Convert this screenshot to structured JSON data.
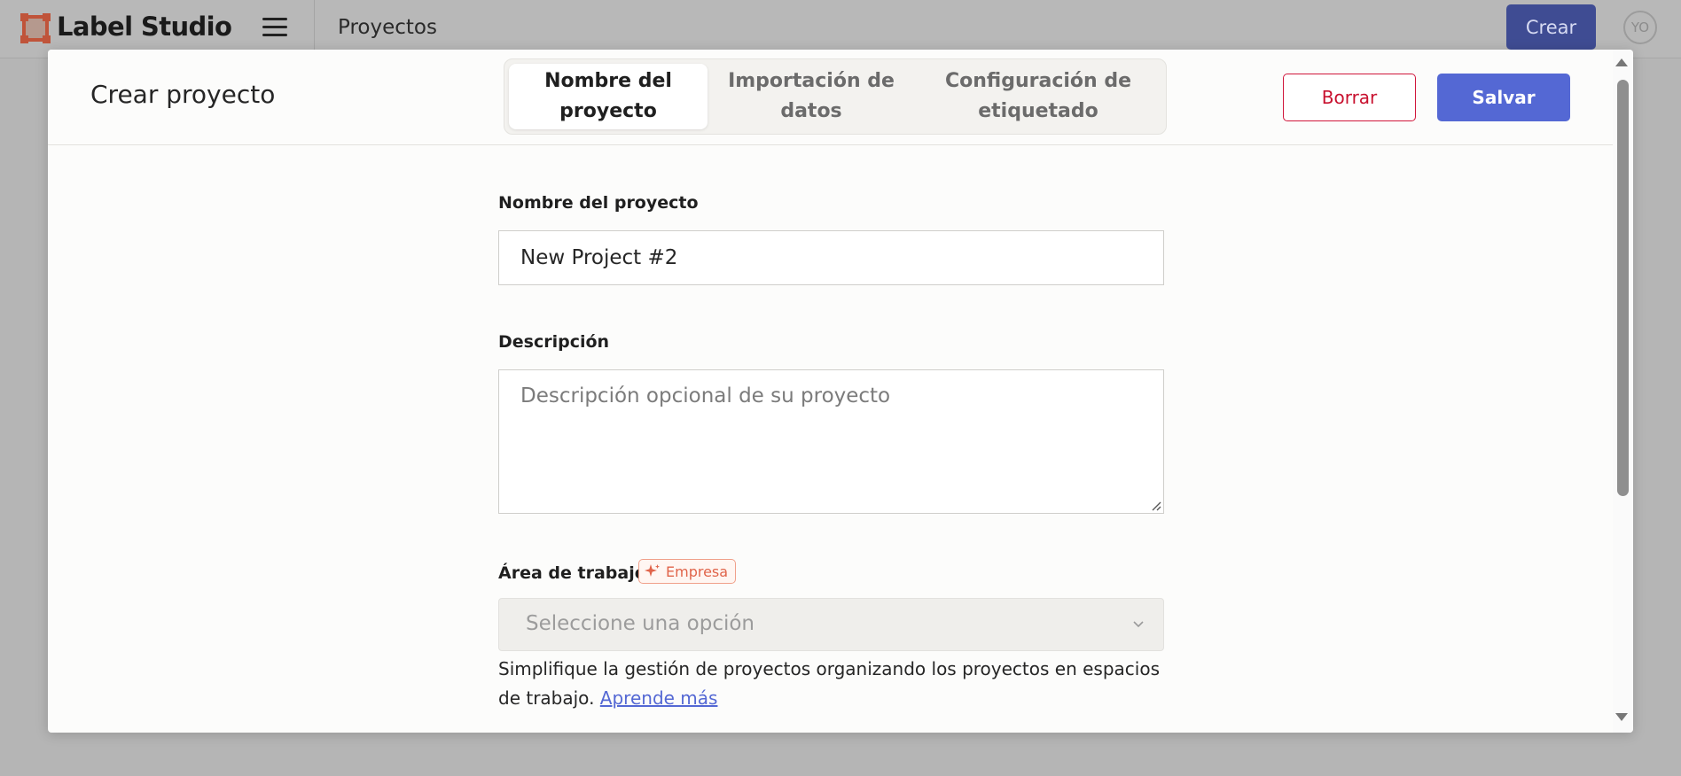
{
  "app": {
    "brand": "Label Studio",
    "breadcrumb": "Proyectos",
    "create_button": "Crear",
    "avatar_initials": "YO"
  },
  "modal": {
    "title": "Crear proyecto",
    "tabs": [
      {
        "label": "Nombre del proyecto",
        "active": true
      },
      {
        "label": "Importación de datos",
        "active": false
      },
      {
        "label": "Configuración de etiquetado",
        "active": false
      }
    ],
    "delete_label": "Borrar",
    "save_label": "Salvar"
  },
  "form": {
    "name_label": "Nombre del proyecto",
    "name_value": "New Project #2",
    "description_label": "Descripción",
    "description_placeholder": "Descripción opcional de su proyecto",
    "workspace_label": "Área de trabajo",
    "workspace_badge": "Empresa",
    "workspace_placeholder": "Seleccione una opción",
    "help_text": "Simplifique la gestión de proyectos organizando los proyectos en espacios de trabajo.",
    "learn_more": "Aprende más"
  },
  "colors": {
    "primary": "#5468d4",
    "danger": "#c8102e",
    "badge": "#e0644a"
  },
  "icons": [
    "label-studio-logo",
    "hamburger-menu-icon",
    "sparkle-icon",
    "chevron-down-icon",
    "resize-grip-icon"
  ]
}
